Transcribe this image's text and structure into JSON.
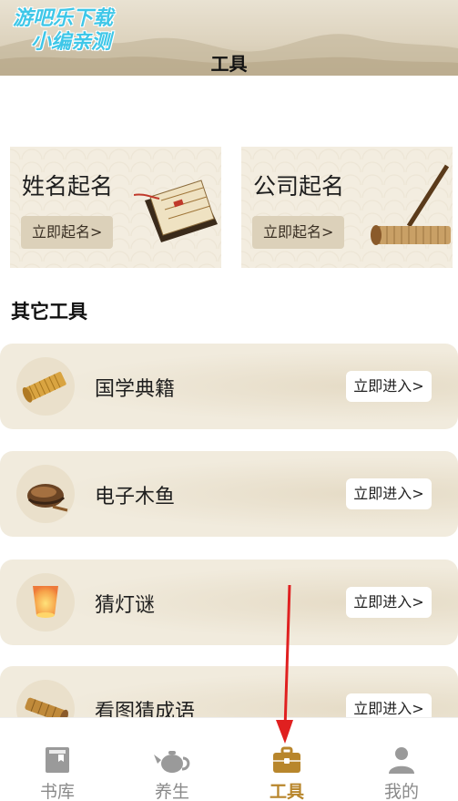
{
  "header": {
    "title": "工具",
    "watermark": [
      "游吧乐下载",
      "小编亲测"
    ]
  },
  "naming_cards": [
    {
      "title": "姓名起名",
      "button": "立即起名>"
    },
    {
      "title": "公司起名",
      "button": "立即起名>"
    }
  ],
  "section_title": "其它工具",
  "tools": [
    {
      "label": "国学典籍",
      "button": "立即进入>",
      "icon": "bamboo-scroll-icon"
    },
    {
      "label": "电子木鱼",
      "button": "立即进入>",
      "icon": "wooden-fish-icon"
    },
    {
      "label": "猜灯谜",
      "button": "立即进入>",
      "icon": "sky-lantern-icon"
    },
    {
      "label": "看图猜成语",
      "button": "立即进入>",
      "icon": "rolled-scroll-icon"
    }
  ],
  "tabbar": [
    {
      "label": "书库",
      "icon": "book-icon",
      "active": false
    },
    {
      "label": "养生",
      "icon": "teapot-icon",
      "active": false
    },
    {
      "label": "工具",
      "icon": "toolbox-icon",
      "active": true
    },
    {
      "label": "我的",
      "icon": "user-icon",
      "active": false
    }
  ],
  "colors": {
    "accent": "#b8862c",
    "card_bg": "#f3ede0",
    "button_bg": "#dcd1ba",
    "tab_inactive": "#8a8a8a",
    "annotation": "#e02020"
  }
}
